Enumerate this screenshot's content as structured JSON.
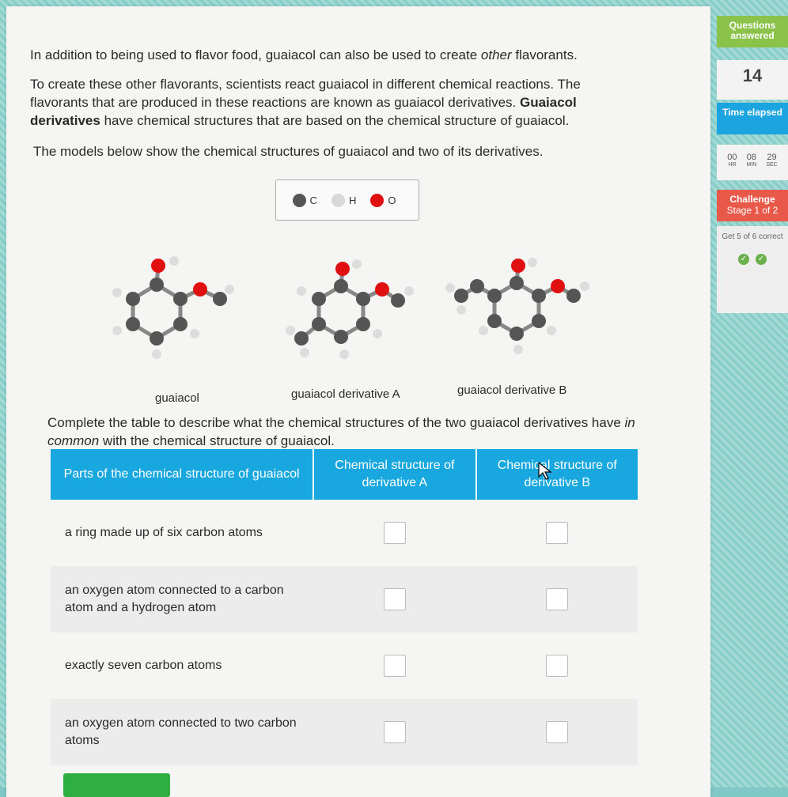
{
  "intro": {
    "p1_start": "In addition to being used to flavor food, guaiacol can also be used to create ",
    "p1_em": "other",
    "p1_end": " flavorants.",
    "p2_start": "To create these other flavorants, scientists react guaiacol in different chemical reactions. The flavorants that are produced in these reactions are known as guaiacol derivatives. ",
    "p2_bold": "Guaiacol derivatives",
    "p2_end": " have chemical structures that are based on the chemical structure of guaiacol.",
    "p3": "The models below show the chemical structures of guaiacol and two of its derivatives."
  },
  "legend": [
    {
      "label": "C",
      "color": "#555555"
    },
    {
      "label": "H",
      "color": "#d8d8d8"
    },
    {
      "label": "O",
      "color": "#e01010"
    }
  ],
  "molecules": [
    {
      "label": "guaiacol"
    },
    {
      "label": "guaiacol derivative A"
    },
    {
      "label": "guaiacol derivative B"
    }
  ],
  "instruction": {
    "start": "Complete the table to describe what the chemical structures of the two guaiacol derivatives have ",
    "em": "in common",
    "end": " with the chemical structure of guaiacol."
  },
  "table": {
    "headers": [
      "Parts of the chemical structure of guaiacol",
      "Chemical structure of derivative A",
      "Chemical structure of derivative B"
    ],
    "rows": [
      {
        "label": "a ring made up of six carbon atoms"
      },
      {
        "label": "an oxygen atom connected to a carbon atom and a hydrogen atom"
      },
      {
        "label": "exactly seven carbon atoms"
      },
      {
        "label": "an oxygen atom connected to two carbon atoms"
      }
    ]
  },
  "sidebar": {
    "questions_answered_label": "Questions answered",
    "questions_answered_value": "14",
    "time_elapsed_label": "Time elapsed",
    "timer": [
      {
        "value": "00",
        "unit": "HR"
      },
      {
        "value": "08",
        "unit": "MIN"
      },
      {
        "value": "29",
        "unit": "SEC"
      }
    ],
    "challenge_label": "Challenge",
    "stage_label": "Stage 1 of 2",
    "goal_label": "Get 5 of 6 correct"
  },
  "colors": {
    "header_blue": "#19a7e0",
    "accent_green": "#8bc34a",
    "challenge_red": "#e8594a",
    "submit_green": "#2fae42"
  }
}
